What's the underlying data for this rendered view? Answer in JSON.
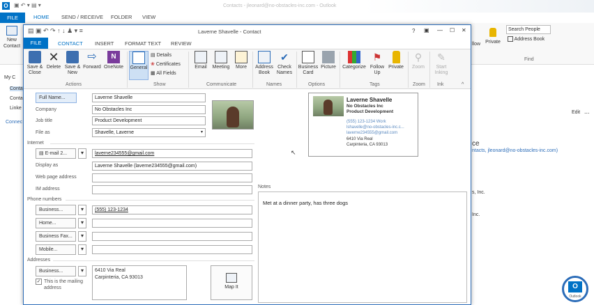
{
  "outlook": {
    "window_title": "Contacts - jleonard@no-obstacles-inc.com - Outlook",
    "tabs": {
      "file": "FILE",
      "home": "HOME",
      "send_receive": "SEND / RECEIVE",
      "folder": "FOLDER",
      "view": "VIEW"
    },
    "ribbon": {
      "new_contact_line1": "New",
      "new_contact_line2": "Contact",
      "search_people": "Search People",
      "address_book": "Address Book",
      "find": "Find",
      "follow": "llow",
      "private": "Private"
    },
    "nav": {
      "my_contacts": "My C",
      "contacts1": "Conta",
      "contacts2": "Conta",
      "linked": "Linke",
      "connect": "Connec"
    },
    "right": {
      "edit": "Edit",
      "dots": "...",
      "fragment1": "ce",
      "fragment2": "ntacts, jleonard@no-obstacles-inc.com)",
      "fragment3": "s, Inc.",
      "fragment4": "Inc."
    },
    "badge": "Outlook"
  },
  "contact_window": {
    "title": "Laverne Shavelle - Contact",
    "controls": {
      "help": "?",
      "ribbon_opts": "▣",
      "minimize": "—",
      "maximize": "☐",
      "close": "✕"
    },
    "tabs": {
      "file": "FILE",
      "contact": "CONTACT",
      "insert": "INSERT",
      "format_text": "FORMAT TEXT",
      "review": "REVIEW"
    },
    "ribbon": {
      "save_close": [
        "Save &",
        "Close"
      ],
      "delete": "Delete",
      "save_new": [
        "Save &",
        "New"
      ],
      "forward": "Forward",
      "onenote": "OneNote",
      "actions_label": "Actions",
      "general": "General",
      "details": "Details",
      "certificates": "Certificates",
      "all_fields": "All Fields",
      "show_label": "Show",
      "email": "Email",
      "meeting": "Meeting",
      "more": "More",
      "communicate_label": "Communicate",
      "address_book": [
        "Address",
        "Book"
      ],
      "check_names": [
        "Check",
        "Names"
      ],
      "names_label": "Names",
      "business_card": [
        "Business",
        "Card"
      ],
      "picture": "Picture",
      "options_label": "Options",
      "categorize": "Categorize",
      "follow_up": [
        "Follow",
        "Up"
      ],
      "private": "Private",
      "tags_label": "Tags",
      "zoom": "Zoom",
      "zoom_label": "Zoom",
      "start_inking": [
        "Start",
        "Inking"
      ],
      "ink_label": "Ink"
    },
    "form": {
      "full_name_btn": "Full Name...",
      "full_name": "Laverne Shavelle",
      "company_label": "Company",
      "company": "No Obstacles Inc",
      "job_title_label": "Job title",
      "job_title": "Product Development",
      "file_as_label": "File as",
      "file_as": "Shavelle, Laverne",
      "internet_label": "Internet",
      "email_btn": "E-mail 2...",
      "email": "laverne234555@gmail.com",
      "display_as_label": "Display as",
      "display_as": "Laverne Shavelle (laverne234555@gmail.com)",
      "web_label": "Web page address",
      "im_label": "IM address",
      "phone_label": "Phone numbers",
      "business_btn": "Business...",
      "business_phone": "(555) 123-1234",
      "home_btn": "Home...",
      "business_fax_btn": "Business Fax...",
      "mobile_btn": "Mobile...",
      "addresses_label": "Addresses",
      "address_btn": "Business...",
      "address_line1": "6410 Via Real",
      "address_line2": "Carpinteria, CA 93013",
      "mailing_check": [
        "This is the mailing",
        "address"
      ],
      "map_it": "Map It",
      "notes_label": "Notes",
      "notes": "Met at a dinner party, has three dogs"
    },
    "card": {
      "name": "Laverne Shavelle",
      "company": "No Obstacles Inc",
      "title": "Product Development",
      "phone": "(555) 123-1234 Work",
      "email1": "lshavelle@no-obstacles-inc.c...",
      "email2": "laverne234555@gmail.com",
      "addr1": "6410 Via Real",
      "addr2": "Carpinteria, CA 93013"
    }
  }
}
